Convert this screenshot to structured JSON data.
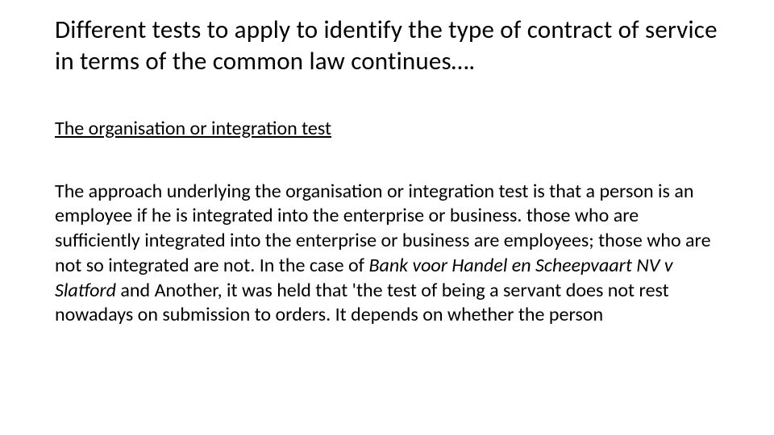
{
  "title": "Different tests to apply to identify the type of contract of service in terms of the common law continues….",
  "subheading": "The organisation or integration test",
  "body_before_case": "The approach underlying the organisation or integration test is that a person is an employee if he is integrated into the enterprise or business. those who are sufficiently integrated into the enterprise or business are employees; those who are not so integrated are not. In the case of ",
  "case_name": "Bank voor Handel en Scheepvaart NV v Slatford ",
  "body_after_case": "and Another, it was held that 'the test of being a servant does not rest nowadays on submission to orders. It depends on whether the person"
}
